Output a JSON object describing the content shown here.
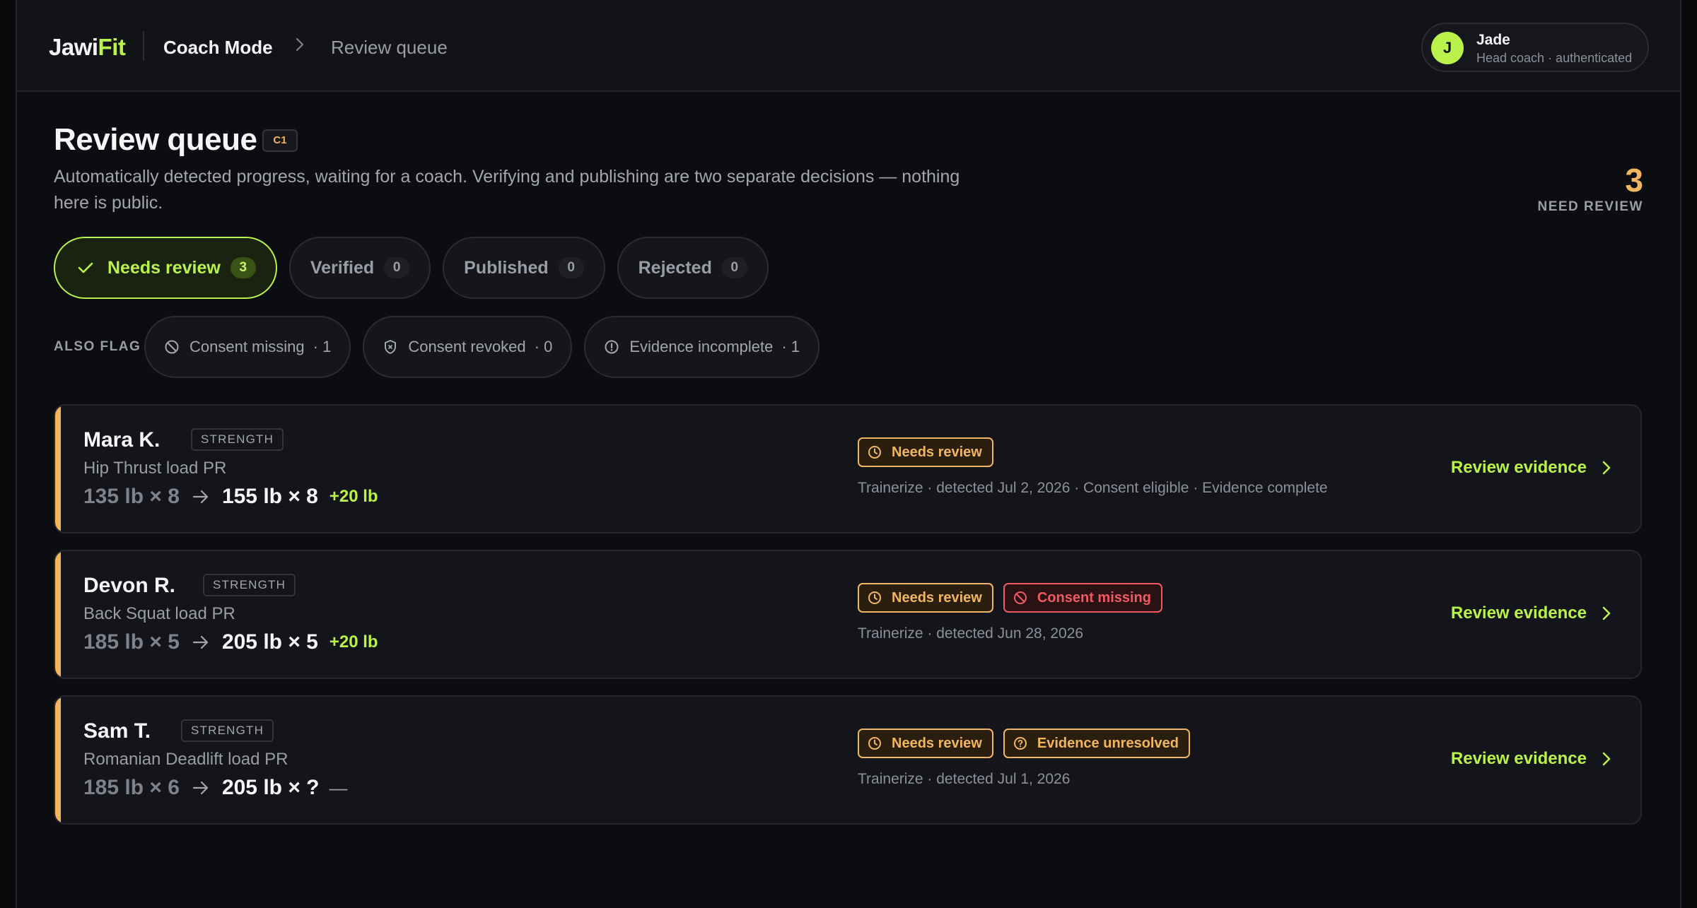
{
  "header": {
    "logo_main": "Jawi",
    "logo_accent": "Fit",
    "mode": "Coach Mode",
    "current_page": "Review queue",
    "user": {
      "initial": "J",
      "name": "Jade",
      "role": "Head coach · authenticated"
    }
  },
  "page": {
    "title": "Review queue",
    "badge": "C1",
    "subtitle": "Automatically detected progress, waiting for a coach. Verifying and publishing are two separate decisions — nothing here is public.",
    "count": "3",
    "count_label": "NEED REVIEW"
  },
  "tabs": [
    {
      "label": "Needs review",
      "count": "3",
      "active": true
    },
    {
      "label": "Verified",
      "count": "0"
    },
    {
      "label": "Published",
      "count": "0"
    },
    {
      "label": "Rejected",
      "count": "0"
    }
  ],
  "flags": {
    "label": "ALSO FLAG",
    "items": [
      {
        "label": "Consent missing",
        "count": "· 1",
        "icon": "ban-icon"
      },
      {
        "label": "Consent revoked",
        "count": "· 0",
        "icon": "shield-icon"
      },
      {
        "label": "Evidence incomplete",
        "count": "· 1",
        "icon": "alert-circle-icon"
      }
    ]
  },
  "cards": [
    {
      "name": "Mara K.",
      "category": "STRENGTH",
      "exercise": "Hip Thrust load PR",
      "from": "135 lb × 8",
      "to": "155 lb × 8",
      "delta": "+20 lb",
      "statuses": [
        {
          "label": "Needs review",
          "kind": "amber",
          "icon": "clock-icon"
        }
      ],
      "meta": "Trainerize · detected Jul 2, 2026 · Consent eligible · Evidence complete",
      "action": "Review evidence"
    },
    {
      "name": "Devon R.",
      "category": "STRENGTH",
      "exercise": "Back Squat load PR",
      "from": "185 lb × 5",
      "to": "205 lb × 5",
      "delta": "+20 lb",
      "statuses": [
        {
          "label": "Needs review",
          "kind": "amber",
          "icon": "clock-icon"
        },
        {
          "label": "Consent missing",
          "kind": "red",
          "icon": "ban-icon"
        }
      ],
      "meta": "Trainerize · detected Jun 28, 2026",
      "action": "Review evidence"
    },
    {
      "name": "Sam T.",
      "category": "STRENGTH",
      "exercise": "Romanian Deadlift load PR",
      "from": "185 lb × 6",
      "to": "205 lb × ?",
      "delta": "—",
      "statuses": [
        {
          "label": "Needs review",
          "kind": "amber",
          "icon": "clock-icon"
        },
        {
          "label": "Evidence unresolved",
          "kind": "amber",
          "icon": "help-circle-icon"
        }
      ],
      "meta": "Trainerize · detected Jul 1, 2026",
      "action": "Review evidence"
    }
  ]
}
